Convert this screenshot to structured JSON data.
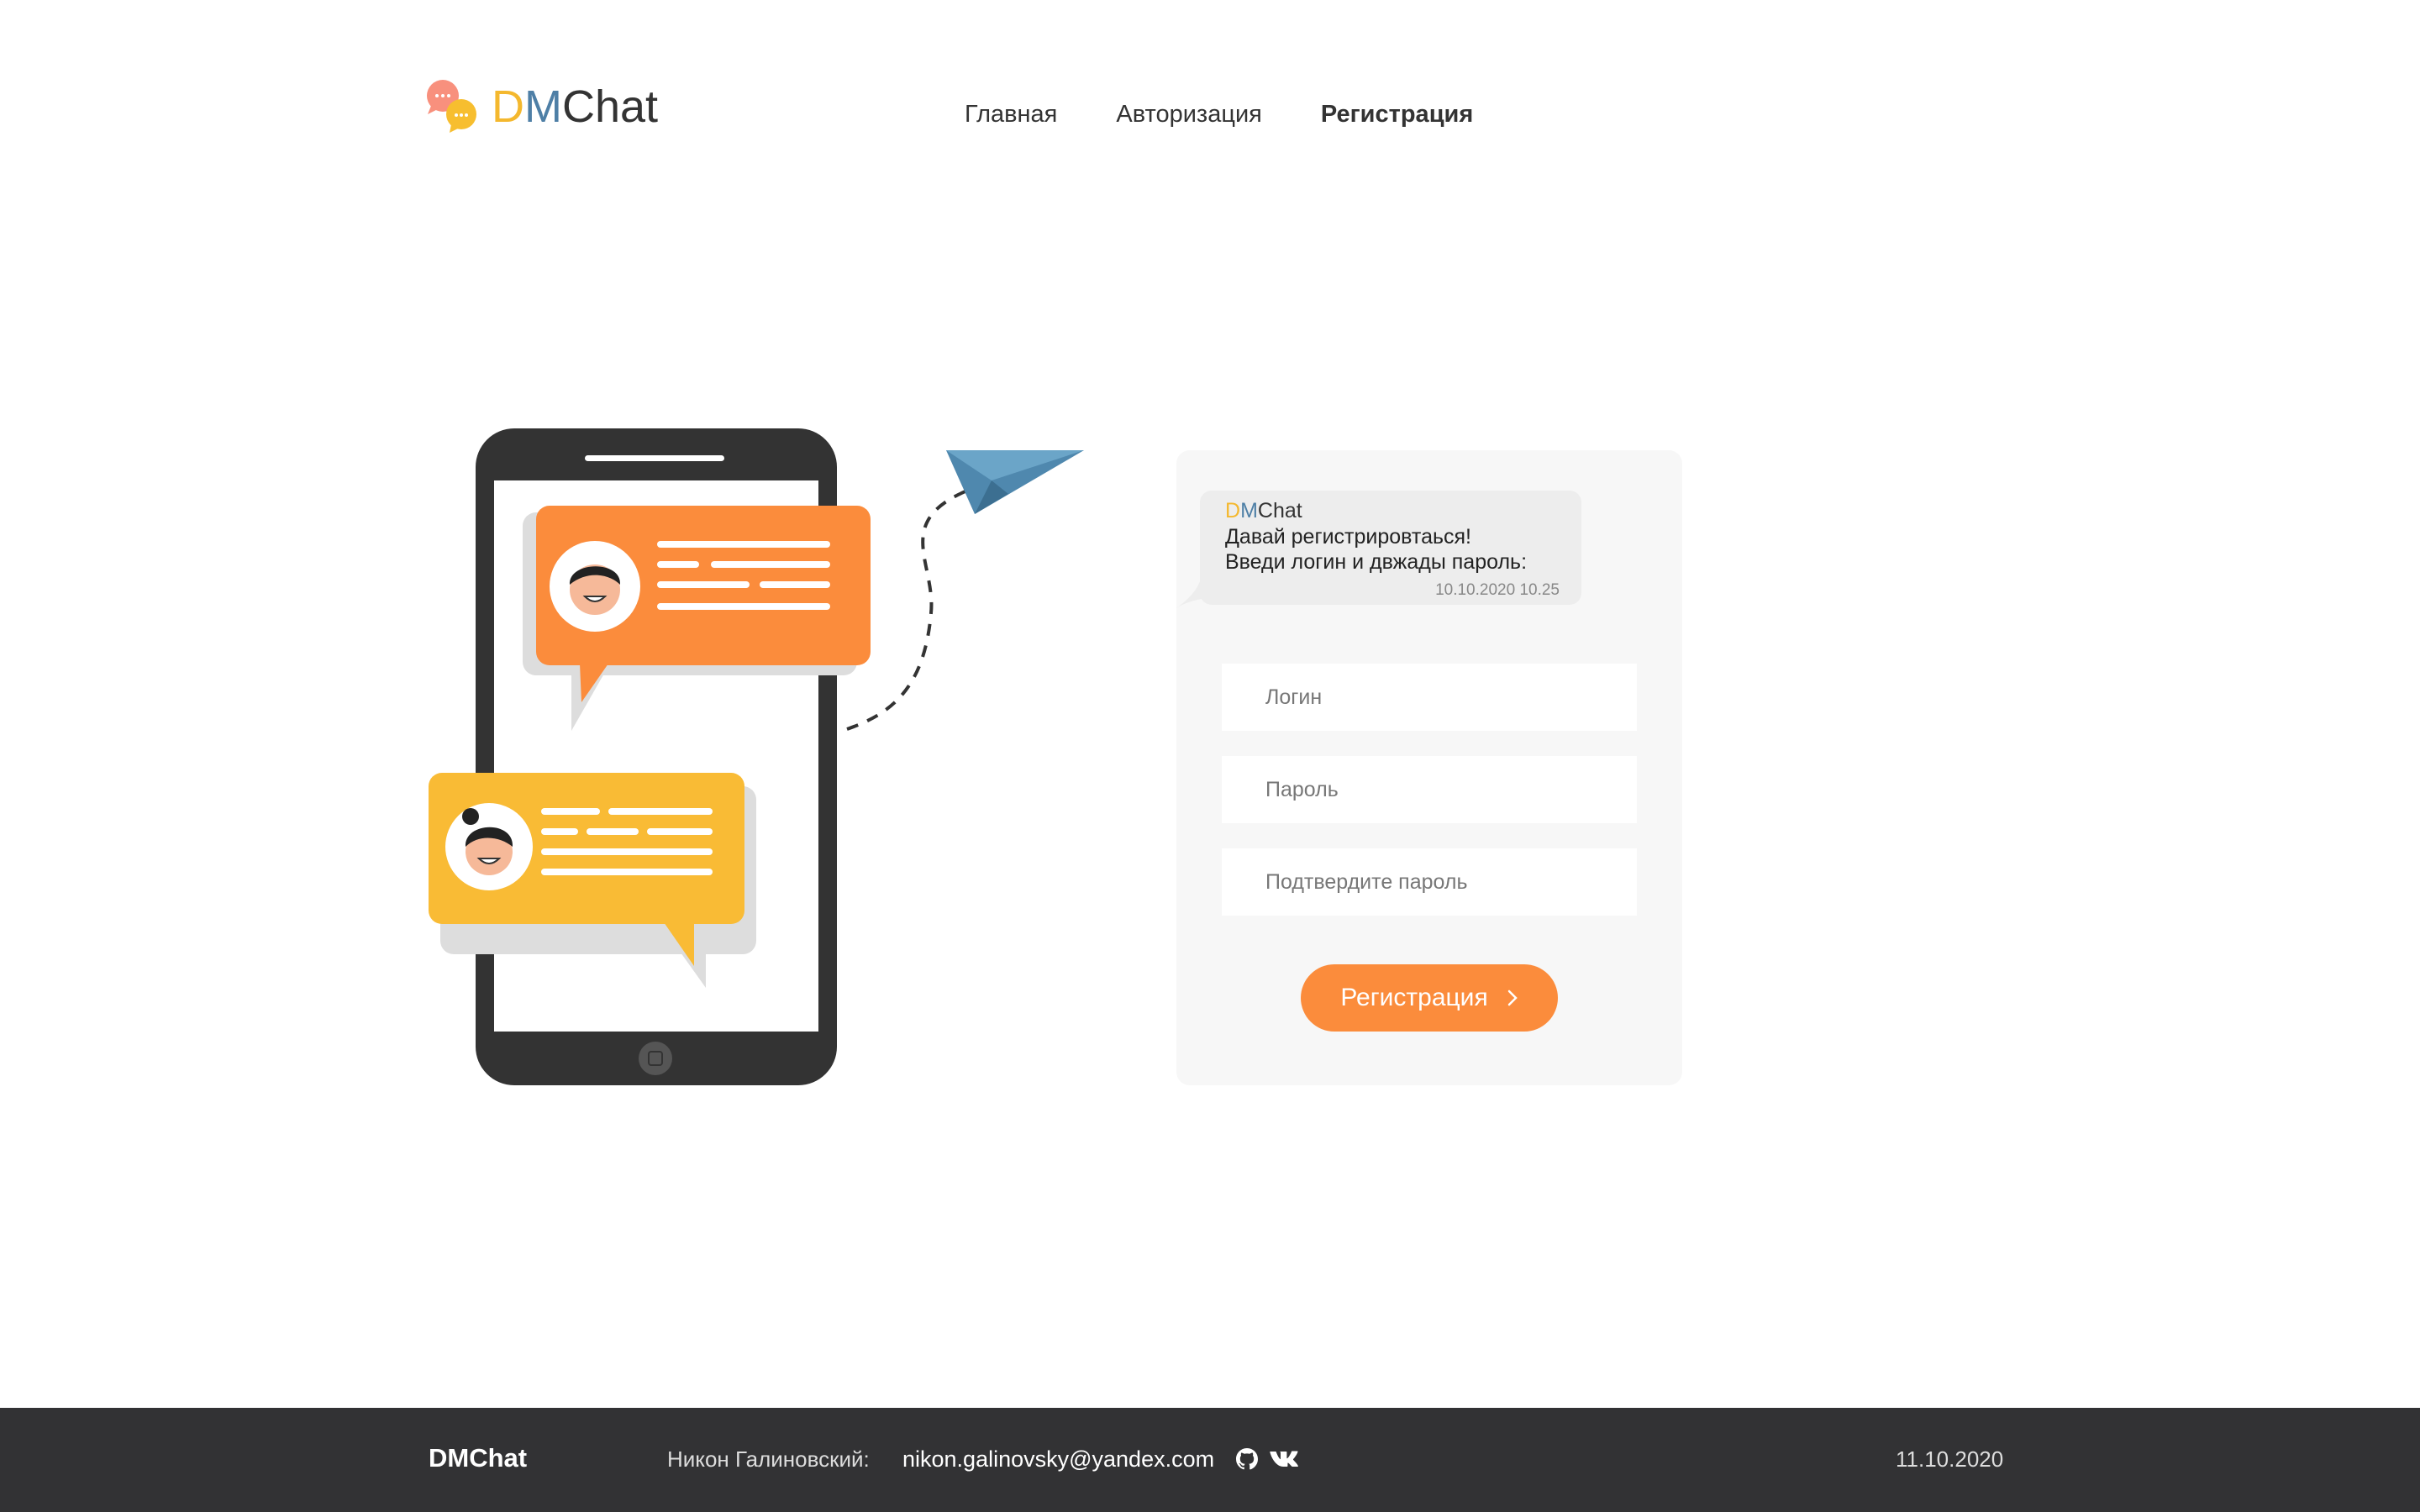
{
  "header": {
    "logo": {
      "d": "D",
      "m": "M",
      "chat": "Chat"
    },
    "nav": [
      {
        "label": "Главная",
        "active": false
      },
      {
        "label": "Авторизация",
        "active": false
      },
      {
        "label": "Регистрация",
        "active": true
      }
    ]
  },
  "card": {
    "message": {
      "sender_d": "D",
      "sender_m": "M",
      "sender_rest": "Chat",
      "line1": "Давай регистрировтаься!",
      "line2": "Введи логин и двжады пароль:",
      "time": "10.10.2020 10.25"
    },
    "fields": {
      "login_placeholder": "Логин",
      "password_placeholder": "Пароль",
      "confirm_placeholder": "Подтвердите пароль"
    },
    "submit_label": "Регистрация",
    "submit_icon": "chevron-right-icon"
  },
  "footer": {
    "brand": "DMChat",
    "author": "Никон Галиновский:",
    "email": "nikon.galinovsky@yandex.com",
    "icons": [
      "github-icon",
      "vk-icon"
    ],
    "date": "11.10.2020"
  },
  "colors": {
    "accent_orange": "#FB8C3C",
    "accent_yellow": "#F4B82E",
    "accent_blue": "#4E7FA6",
    "footer_bg": "#323234",
    "card_bg": "#F7F7F7"
  }
}
